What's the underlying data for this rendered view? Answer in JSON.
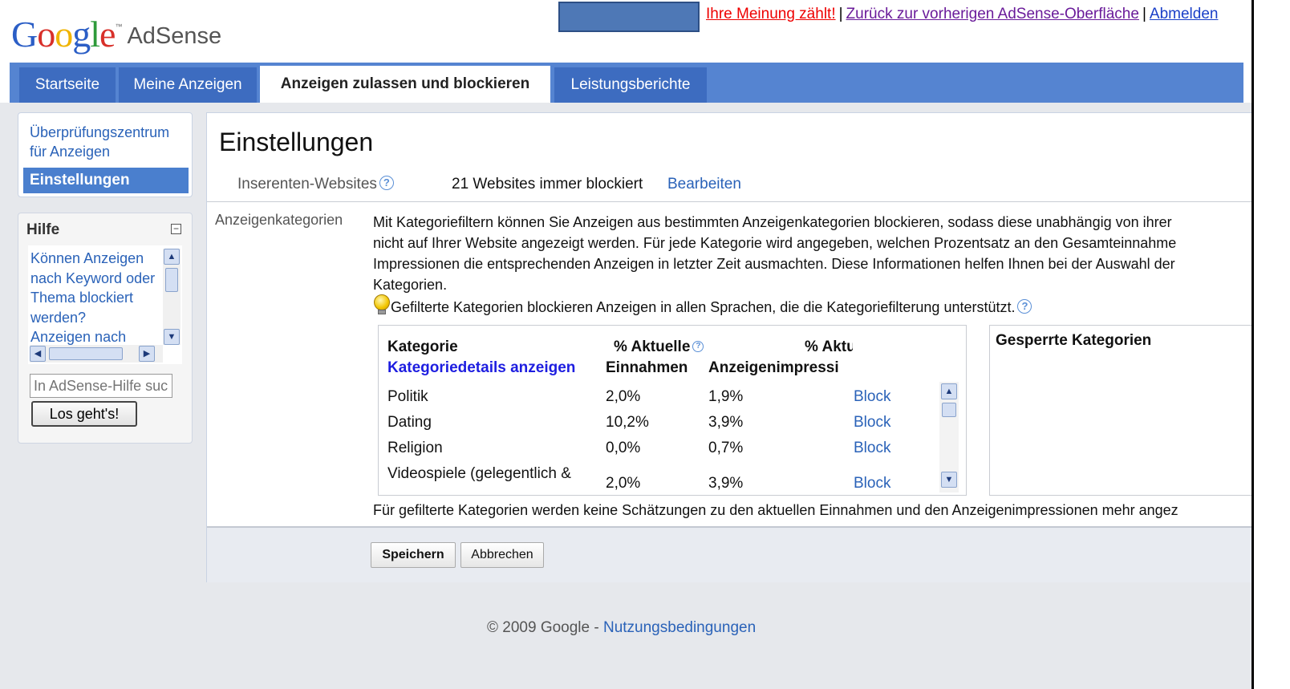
{
  "header": {
    "logo_google": "Google",
    "logo_tm": "™",
    "logo_product": "AdSense",
    "links": [
      {
        "label": "Ihre Meinung zählt!"
      },
      {
        "label": "Zurück zur vorherigen AdSense-Oberfläche"
      },
      {
        "label": "Abmelden"
      }
    ],
    "separator": "|"
  },
  "tabs": [
    {
      "label": "Startseite"
    },
    {
      "label": "Meine Anzeigen"
    },
    {
      "label": "Anzeigen zulassen und blockieren"
    },
    {
      "label": "Leistungsberichte"
    }
  ],
  "sidebar": {
    "items": [
      {
        "label_line1": "Überprüfungszentrum",
        "label_line2": "für Anzeigen"
      },
      {
        "label": "Einstellungen"
      }
    ]
  },
  "help": {
    "title": "Hilfe",
    "collapse": "−",
    "links_text": [
      "Können Anzeigen",
      "nach Keyword oder",
      "Thema blockiert",
      "werden?",
      "Anzeigen nach"
    ],
    "search_placeholder": "In AdSense-Hilfe suchen",
    "search_button": "Los geht's!"
  },
  "main": {
    "title": "Einstellungen",
    "advertiser_label": "Inserenten-Websites",
    "advertiser_value": "21 Websites immer blockiert",
    "advertiser_edit": "Bearbeiten",
    "categories_label": "Anzeigenkategorien",
    "description_lines": [
      "Mit Kategoriefiltern können Sie Anzeigen aus bestimmten Anzeigenkategorien blockieren, sodass diese unabhängig von ihrer",
      "nicht auf Ihrer Website angezeigt werden. Für jede Kategorie wird angegeben, welchen Prozentsatz an den Gesamteinnahme",
      "Impressionen die entsprechenden Anzeigen in letzter Zeit ausmachten. Diese Informationen helfen Ihnen bei der Auswahl der",
      "Kategorien."
    ],
    "hint": "Gefilterte Kategorien blockieren Anzeigen in allen Sprachen, die die Kategoriefilterung unterstützt.",
    "table": {
      "col_category": "Kategorie",
      "col_details_link": "Kategoriedetails anzeigen",
      "col_revenue_1": "% Aktuelle",
      "col_revenue_2": "Einnahmen",
      "col_impr_1": "% Aktu",
      "col_impr_2": "Anzeigenimpressi",
      "rows": [
        {
          "category": "Politik",
          "revenue": "2,0%",
          "impressions": "1,9%",
          "action": "Block"
        },
        {
          "category": "Dating",
          "revenue": "10,2%",
          "impressions": "3,9%",
          "action": "Block"
        },
        {
          "category": "Religion",
          "revenue": "0,0%",
          "impressions": "0,7%",
          "action": "Block"
        },
        {
          "category": "Videospiele (gelegentlich &",
          "revenue": "2,0%",
          "impressions": "3,9%",
          "action": "Block"
        }
      ]
    },
    "blocked_header": "Gesperrte Kategorien",
    "note": "Für gefilterte Kategorien werden keine Schätzungen zu den aktuellen Einnahmen und den Anzeigenimpressionen mehr angez",
    "save_button": "Speichern",
    "cancel_button": "Abbrechen"
  },
  "footer": {
    "copyright": "© 2009 Google -",
    "terms_link": "Nutzungsbedingungen"
  },
  "colors": {
    "tab_bar": "#5584d1",
    "tab_inactive": "#3d6cc0",
    "link_blue": "#2a62b8",
    "link_red": "#e00000",
    "link_purple": "#6a1b9a",
    "page_gray": "#e6e8ec"
  }
}
